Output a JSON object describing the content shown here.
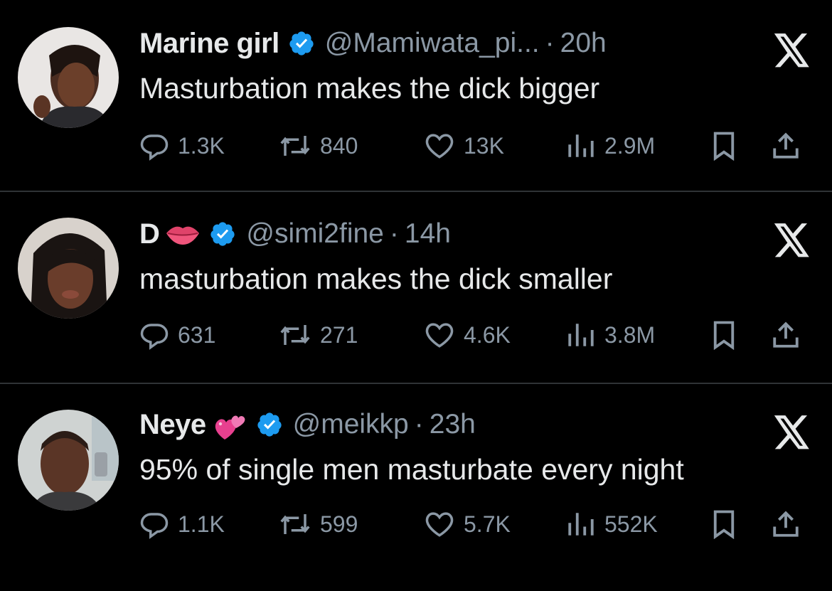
{
  "colors": {
    "background": "#000000",
    "text": "#e7e9ea",
    "secondary": "#8b98a5",
    "verified": "#1d9bf0",
    "divider": "#2f3336"
  },
  "tweets": [
    {
      "display_name": "Marine girl",
      "name_emoji": "",
      "verified": true,
      "handle": "@Mamiwata_pi...",
      "separator": "·",
      "time": "20h",
      "text": "Masturbation makes the dick bigger",
      "replies": "1.3K",
      "retweets": "840",
      "likes": "13K",
      "views": "2.9M"
    },
    {
      "display_name": "D",
      "name_emoji": "lips-emoji",
      "verified": true,
      "handle": "@simi2fine",
      "separator": "·",
      "time": "14h",
      "text": "masturbation makes the dick smaller",
      "replies": "631",
      "retweets": "271",
      "likes": "4.6K",
      "views": "3.8M"
    },
    {
      "display_name": "Neye",
      "name_emoji": "two-hearts-emoji",
      "verified": true,
      "handle": "@meikkp",
      "separator": "·",
      "time": "23h",
      "text": "95% of single men masturbate every night",
      "replies": "1.1K",
      "retweets": "599",
      "likes": "5.7K",
      "views": "552K"
    }
  ]
}
